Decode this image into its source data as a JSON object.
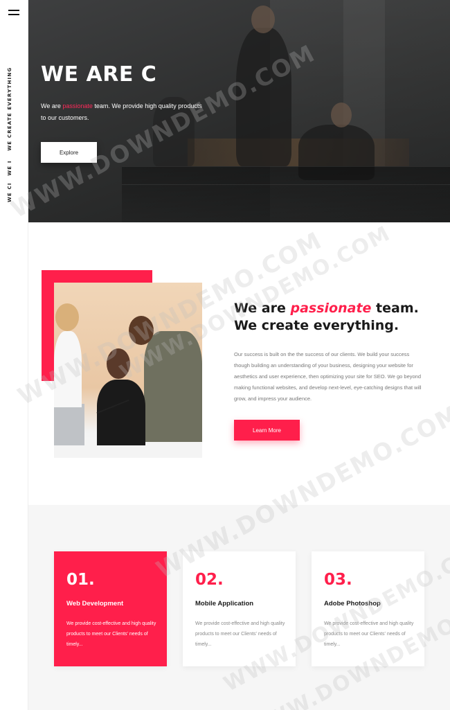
{
  "rail": {
    "menu_icon": "hamburger-icon",
    "vertical_text_a": "WE CI",
    "vertical_text_b": "WE I",
    "vertical_text_c": "WE CREATE EVERYTHING"
  },
  "hero": {
    "title": "WE ARE C",
    "text_before": "We are ",
    "text_highlight": "passionate",
    "text_after": " team. We provide high quality products to our customers.",
    "button_label": "Explore"
  },
  "about": {
    "heading_before": "We are ",
    "heading_highlight": "passionate",
    "heading_after": " team. We create everything.",
    "description": "Our success is built on the the success of our clients. We build your success though building an understanding of your business, designing your website for aesthetics and user experience, then optimizing your site for SEO. We go beyond making functional websites, and develop next-level, eye-catching designs that will grow, and impress your audience.",
    "button_label": "Learn More"
  },
  "services": [
    {
      "num": "01.",
      "title": "Web Development",
      "text": "We provide cost-effective and high quality products to meet our Clients' needs of timely..."
    },
    {
      "num": "02.",
      "title": "Mobile Application",
      "text": "We provide cost-effective and high quality products to meet our Clients' needs of timely..."
    },
    {
      "num": "03.",
      "title": "Adobe Photoshop",
      "text": "We provide cost-effective and high quality products to meet our Clients' needs of timely..."
    }
  ],
  "watermark": "WWW.DOWNDEMO.COM",
  "colors": {
    "accent": "#ff1f4b",
    "hero_bg": "#2b2c2c",
    "services_bg": "#f6f6f6"
  }
}
